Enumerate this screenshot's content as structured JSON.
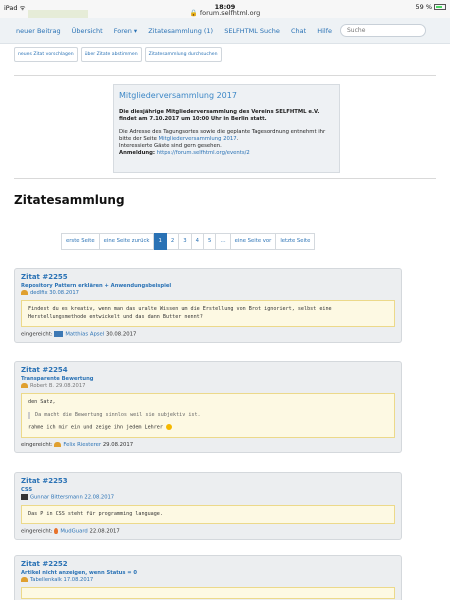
{
  "status_bar": {
    "device": "iPad",
    "wifi": "ᯤ",
    "time": "18:09",
    "url": "forum.selfhtml.org",
    "battery": "59 %"
  },
  "nav": {
    "links": [
      "neuer Beitrag",
      "Übersicht",
      "Foren ▾",
      "Zitatesammlung (1)",
      "SELFHTML Suche",
      "Chat",
      "Hilfe"
    ],
    "search_placeholder": "Suche"
  },
  "sub_buttons": [
    "neues Zitat vorschlagen",
    "über Zitate abstimmen",
    "Zitatesammlung durchsuchen"
  ],
  "notice": {
    "title": "Mitgliederversammlung 2017",
    "bold_text": "Die diesjährige Mitgliederversammlung des Vereins SELFHTML e.V. findet am 7.10.2017 um 10:00 Uhr in Berlin statt.",
    "text_before_link": "Die Adresse des Tagungsortes sowie die geplante Tagesordnung entnehmt ihr bitte der Seite ",
    "link": "Mitgliederversammlung 2017",
    "text_after_link": ".",
    "guests": "Interessierte Gäste sind gern gesehen.",
    "signup_label": "Anmeldung:",
    "signup_url": "https://forum.selfhtml.org/events/2"
  },
  "page_title": "Zitatesammlung",
  "pagination": {
    "first": "erste Seite",
    "prev": "eine Seite zurück",
    "pages": [
      "1",
      "2",
      "3",
      "4",
      "5",
      "…"
    ],
    "next": "eine Seite vor",
    "last": "letzte Seite",
    "active": "1"
  },
  "quotes": [
    {
      "title": "Zitat #2255",
      "subject": "Repository Pattern erklären + Anwendungsbeispiel",
      "author": "dedlfix",
      "date": "30.08.2017",
      "body": "Findest du es kreativ, wenn man das uralte Wissen um die Erstellung von Brot ignoriert, selbst eine Herstellungsmethode entwickelt und das dann Butter nennt?",
      "submitted_label": "eingereicht:",
      "submitter": "Matthias Apsel",
      "submitted_date": "30.08.2017"
    },
    {
      "title": "Zitat #2254",
      "subject": "Transparente Bewertung",
      "author": "Robert B.",
      "date": "29.08.2017",
      "body_line1": "den Satz,",
      "body_quote": "Da macht die Bewertung sinnlos weil sie subjektiv ist.",
      "body_line2": "rahme ich mir ein und zeige ihn jedem Lehrer",
      "submitted_label": "eingereicht:",
      "submitter": "Felix Riesterer",
      "submitted_date": "29.08.2017"
    },
    {
      "title": "Zitat #2253",
      "subject": "CSS",
      "author": "Gunnar Bittersmann",
      "date": "22.08.2017",
      "body": "Das P in CSS steht für programming language.",
      "submitted_label": "eingereicht:",
      "submitter": "MudGuard",
      "submitted_date": "22.08.2017"
    },
    {
      "title": "Zitat #2252",
      "subject": "Artikel nicht anzeigen, wenn Status = 0",
      "author": "Tabellenkalk",
      "date": "17.08.2017"
    }
  ]
}
